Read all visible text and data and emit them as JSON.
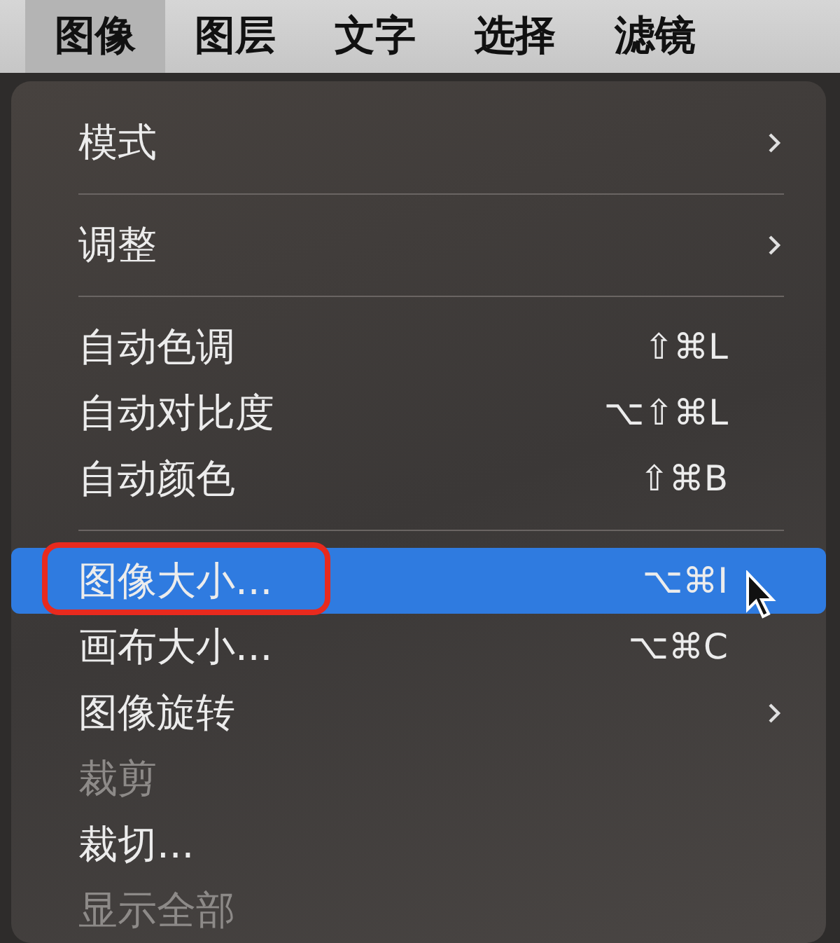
{
  "menu_bar": [
    {
      "label": "图像",
      "selected": true
    },
    {
      "label": "图层",
      "selected": false
    },
    {
      "label": "文字",
      "selected": false
    },
    {
      "label": "选择",
      "selected": false
    },
    {
      "label": "滤镜",
      "selected": false
    }
  ],
  "menu": {
    "items": [
      {
        "kind": "item",
        "label": "模式",
        "submenu": true,
        "selected": false,
        "disabled": false
      },
      {
        "kind": "divider"
      },
      {
        "kind": "item",
        "label": "调整",
        "submenu": true,
        "selected": false,
        "disabled": false
      },
      {
        "kind": "divider"
      },
      {
        "kind": "item",
        "label": "自动色调",
        "shortcut": "⇧⌘L",
        "selected": false,
        "disabled": false
      },
      {
        "kind": "item",
        "label": "自动对比度",
        "shortcut": "⌥⇧⌘L",
        "selected": false,
        "disabled": false
      },
      {
        "kind": "item",
        "label": "自动颜色",
        "shortcut": "⇧⌘B",
        "selected": false,
        "disabled": false
      },
      {
        "kind": "divider"
      },
      {
        "kind": "item",
        "label": "图像大小...",
        "shortcut": "⌥⌘I",
        "selected": true,
        "disabled": false,
        "highlighted": true
      },
      {
        "kind": "item",
        "label": "画布大小...",
        "shortcut": "⌥⌘C",
        "selected": false,
        "disabled": false
      },
      {
        "kind": "item",
        "label": "图像旋转",
        "submenu": true,
        "selected": false,
        "disabled": false
      },
      {
        "kind": "item",
        "label": "裁剪",
        "selected": false,
        "disabled": true
      },
      {
        "kind": "item",
        "label": "裁切...",
        "selected": false,
        "disabled": false
      },
      {
        "kind": "item",
        "label": "显示全部",
        "selected": false,
        "disabled": true
      }
    ]
  }
}
